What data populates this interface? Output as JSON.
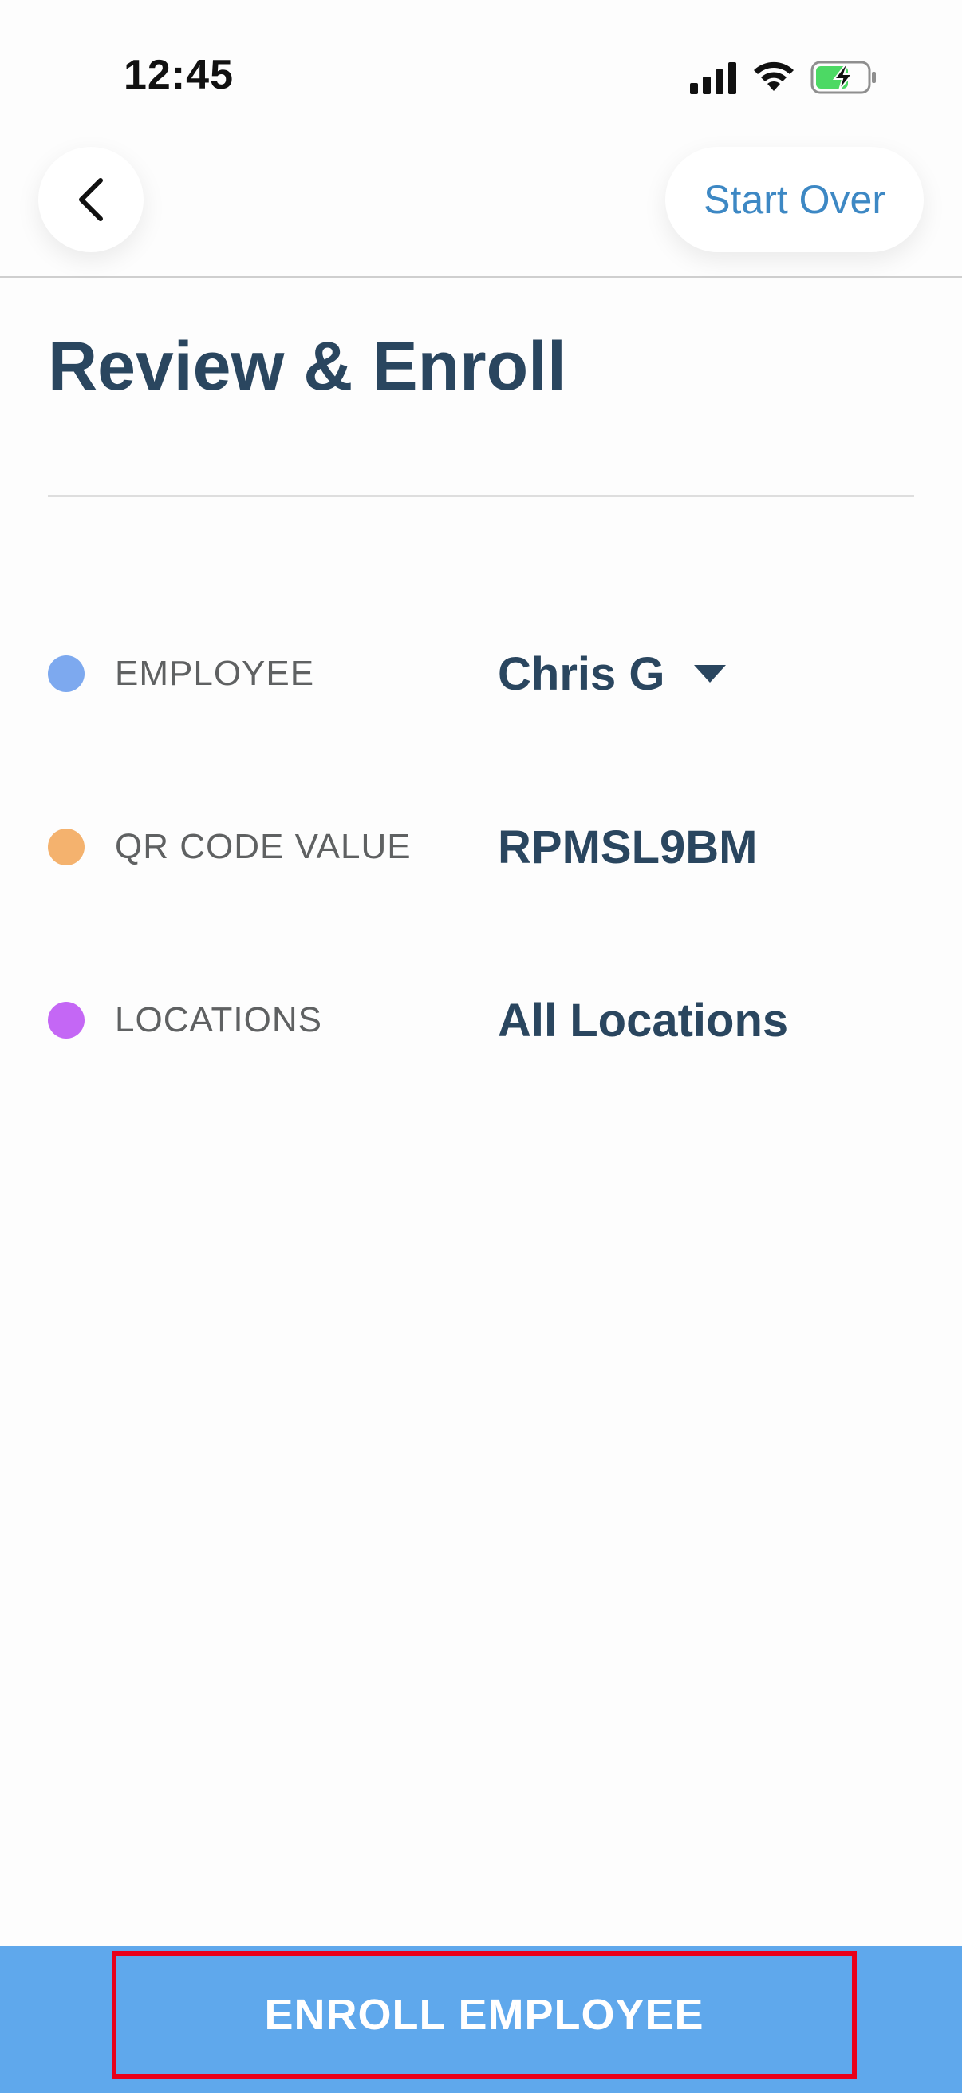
{
  "status_bar": {
    "time": "12:45",
    "icons": [
      "signal-icon",
      "wifi-icon",
      "battery-charging-icon"
    ],
    "battery_color": "#4cd964"
  },
  "header": {
    "back_icon": "chevron-left-icon",
    "start_over_label": "Start Over"
  },
  "page": {
    "title": "Review & Enroll"
  },
  "rows": [
    {
      "label": "EMPLOYEE",
      "value": "Chris G",
      "dot_color": "#7da9ef",
      "has_dropdown": true
    },
    {
      "label": "QR CODE VALUE",
      "value": "RPMSL9BM",
      "dot_color": "#f4b26e",
      "has_dropdown": false
    },
    {
      "label": "LOCATIONS",
      "value": "All Locations",
      "dot_color": "#c467f5",
      "has_dropdown": false
    }
  ],
  "footer": {
    "enroll_label": "ENROLL EMPLOYEE",
    "bar_color": "#5fa8ec",
    "highlight_color": "#e8001a"
  }
}
